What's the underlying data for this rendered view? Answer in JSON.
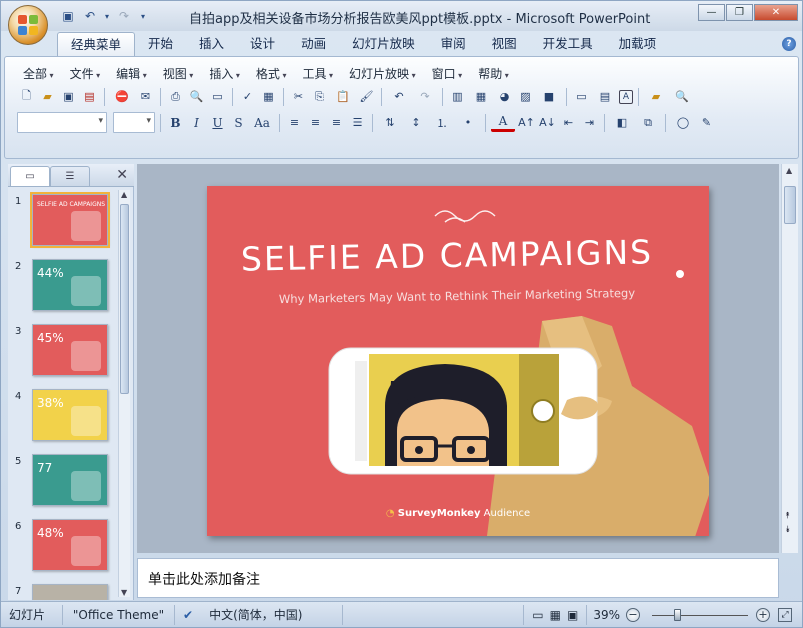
{
  "window": {
    "title": "自拍app及相关设备市场分析报告欧美风ppt模板.pptx - Microsoft PowerPoint",
    "minimize": "—",
    "maximize": "❐",
    "close": "✕"
  },
  "tabs": [
    {
      "label": "经典菜单",
      "active": true
    },
    {
      "label": "开始"
    },
    {
      "label": "插入"
    },
    {
      "label": "设计"
    },
    {
      "label": "动画"
    },
    {
      "label": "幻灯片放映"
    },
    {
      "label": "审阅"
    },
    {
      "label": "视图"
    },
    {
      "label": "开发工具"
    },
    {
      "label": "加载项"
    }
  ],
  "menu": [
    "全部",
    "文件",
    "编辑",
    "视图",
    "插入",
    "格式",
    "工具",
    "幻灯片放映",
    "窗口",
    "帮助"
  ],
  "format_buttons": {
    "bold": "B",
    "italic": "I",
    "underline": "U",
    "shadow": "S",
    "case": "Aa",
    "font_color": "A"
  },
  "pane": {
    "close_glyph": "✕"
  },
  "thumbnails": [
    {
      "num": "1",
      "bg": "#e25c5c",
      "text": "SELFIE AD CAMPAIGNS",
      "selected": true
    },
    {
      "num": "2",
      "bg": "#3a9b8f",
      "text": "44%"
    },
    {
      "num": "3",
      "bg": "#e25c5c",
      "text": "45%"
    },
    {
      "num": "4",
      "bg": "#f2d24a",
      "text": "38%"
    },
    {
      "num": "5",
      "bg": "#3a9b8f",
      "text": "77"
    },
    {
      "num": "6",
      "bg": "#e25c5c",
      "text": "48%"
    },
    {
      "num": "7",
      "bg": "#b8b2a6",
      "text": ""
    }
  ],
  "slide": {
    "title": "SELFIE AD CAMPAIGNS",
    "subtitle": "Why Marketers May Want to Rethink Their Marketing Strategy",
    "brand": "SurveyMonkey",
    "brand_suffix": "Audience",
    "bg": "#e25c5c"
  },
  "notes": {
    "placeholder": "单击此处添加备注"
  },
  "status": {
    "view": "幻灯片",
    "theme": "\"Office Theme\"",
    "language": "中文(简体，中国)",
    "zoom": "39%"
  }
}
